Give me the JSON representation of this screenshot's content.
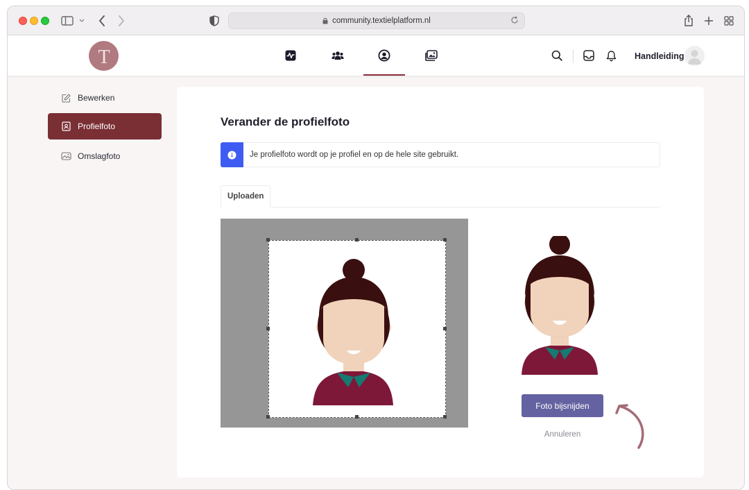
{
  "browser": {
    "url": "community.textielplatform.nl"
  },
  "header": {
    "logo_letter": "T",
    "nav": [
      "activity",
      "groups",
      "profile",
      "photos"
    ],
    "user_label": "Handleiding"
  },
  "sidebar": {
    "items": [
      {
        "label": "Bewerken",
        "icon": "edit-icon",
        "active": false
      },
      {
        "label": "Profielfoto",
        "icon": "contact-card-icon",
        "active": true
      },
      {
        "label": "Omslagfoto",
        "icon": "image-icon",
        "active": false
      }
    ]
  },
  "main": {
    "title": "Verander de profielfoto",
    "notice": "Je profielfoto wordt op je profiel en op de hele site gebruikt.",
    "tabs": [
      "Uploaden"
    ],
    "crop_button": "Foto bijsnijden",
    "cancel_link": "Annuleren"
  },
  "colors": {
    "brand": "#7a2f35",
    "logo": "#b07a80",
    "info": "#3f5cf2",
    "button": "#6462a0",
    "shirt": "#7e1838",
    "hair": "#3a0f0f",
    "skin": "#f1d3bb",
    "collar": "#147a72"
  }
}
